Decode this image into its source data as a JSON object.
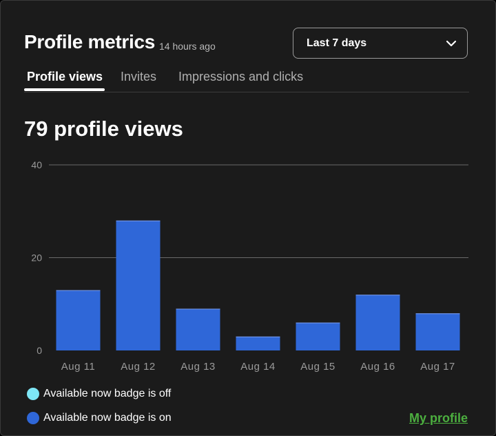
{
  "header": {
    "title": "Profile metrics",
    "updated": "14 hours ago",
    "range_dropdown": {
      "selected": "Last 7 days"
    }
  },
  "tabs": [
    {
      "label": "Profile views",
      "active": true
    },
    {
      "label": "Invites",
      "active": false
    },
    {
      "label": "Impressions and clicks",
      "active": false
    }
  ],
  "summary": {
    "headline": "79 profile views"
  },
  "chart_data": {
    "type": "bar",
    "categories": [
      "Aug 11",
      "Aug 12",
      "Aug 13",
      "Aug 14",
      "Aug 15",
      "Aug 16",
      "Aug 17"
    ],
    "series": [
      {
        "name": "Available now badge is on",
        "color": "#2f67d8",
        "values": [
          13,
          28,
          9,
          3,
          6,
          12,
          8
        ]
      }
    ],
    "yticks": [
      0,
      20,
      40
    ],
    "ylim": [
      0,
      40
    ],
    "grid": true
  },
  "legend": [
    {
      "label": "Available now badge is off",
      "color": "#7ee6f5"
    },
    {
      "label": "Available now badge is on",
      "color": "#2f67d8"
    }
  ],
  "footer": {
    "link_label": "My profile"
  },
  "colors": {
    "background": "#1b1b1b",
    "bar": "#2f67d8",
    "link": "#4caf3f"
  },
  "icons": {
    "dropdown": "chevron-down-icon"
  }
}
